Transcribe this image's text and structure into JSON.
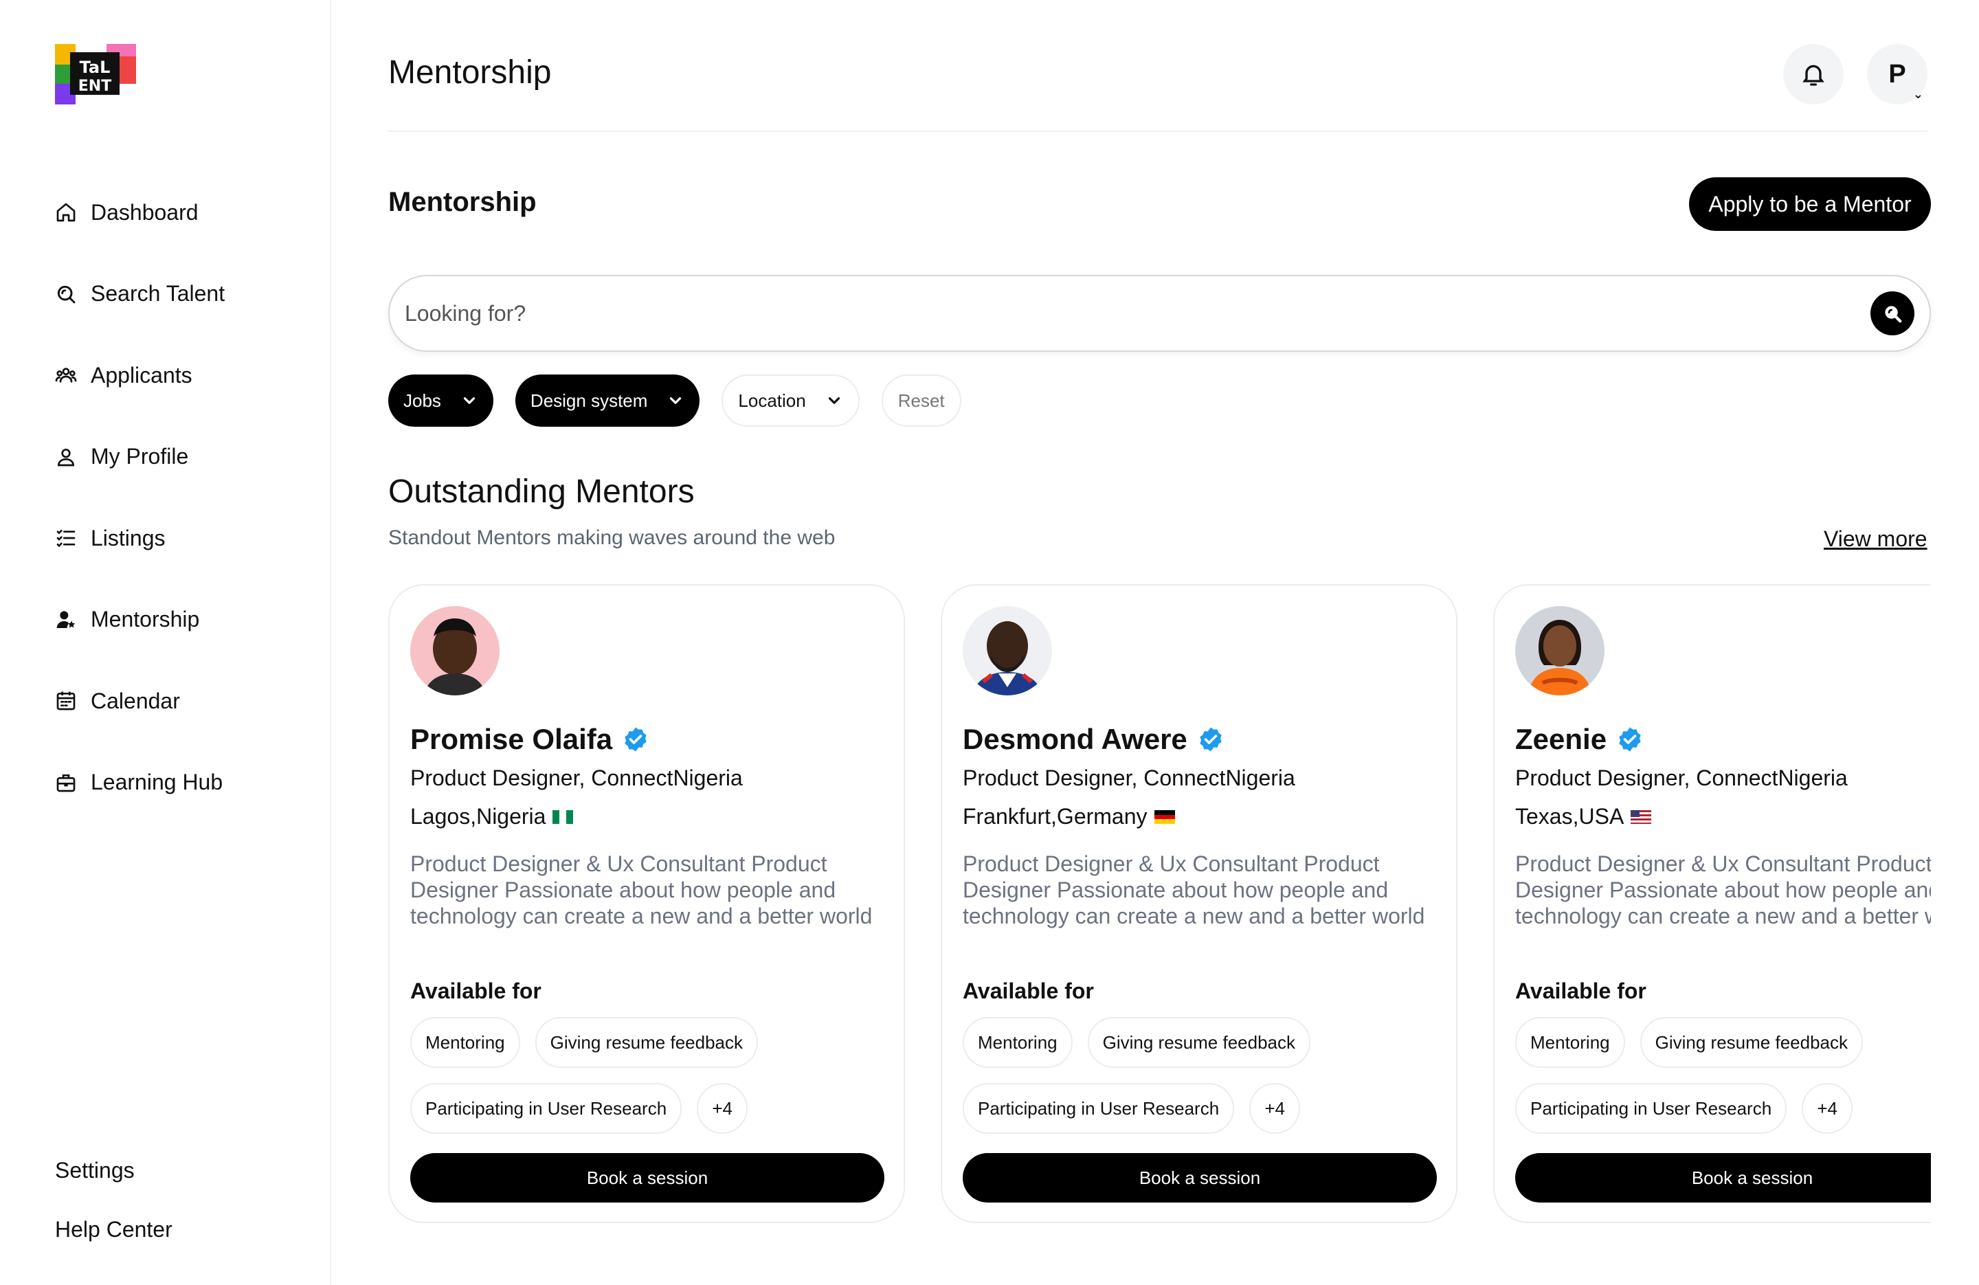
{
  "brand": {
    "logo_text_line1": "TaL",
    "logo_text_line2": "ENT"
  },
  "sidebar": {
    "items": [
      {
        "label": "Dashboard",
        "icon": "home-icon"
      },
      {
        "label": "Search Talent",
        "icon": "search-icon"
      },
      {
        "label": "Applicants",
        "icon": "users-icon"
      },
      {
        "label": "My Profile",
        "icon": "user-icon"
      },
      {
        "label": "Listings",
        "icon": "list-icon"
      },
      {
        "label": "Mentorship",
        "icon": "mentorship-icon",
        "active": true
      },
      {
        "label": "Calendar",
        "icon": "calendar-icon"
      },
      {
        "label": "Learning Hub",
        "icon": "briefcase-icon"
      }
    ],
    "bottom": {
      "settings": "Settings",
      "help": "Help Center"
    }
  },
  "header": {
    "title": "Mentorship",
    "avatar_initial": "P"
  },
  "main": {
    "section_title": "Mentorship",
    "apply_label": "Apply to be a Mentor",
    "search": {
      "placeholder": "Looking for?"
    },
    "filters": [
      {
        "label": "Jobs",
        "style": "dark"
      },
      {
        "label": "Design system",
        "style": "dark"
      },
      {
        "label": "Location",
        "style": "light"
      }
    ],
    "reset_label": "Reset",
    "outstanding": {
      "title": "Outstanding Mentors",
      "subtitle": "Standout Mentors making waves around the web",
      "view_more": "View more"
    }
  },
  "mentors": [
    {
      "name": "Promise Olaifa",
      "role": "Product Designer, ConnectNigeria",
      "location": "Lagos,Nigeria",
      "flag": "nigeria",
      "bio": "Product Designer & Ux Consultant Product Designer Passionate about how people and technology can create a new and a better world",
      "available_label": "Available for",
      "tags": [
        "Mentoring",
        "Giving resume feedback",
        "Participating in User Research"
      ],
      "more": "+4",
      "book_label": "Book a session"
    },
    {
      "name": "Desmond Awere",
      "role": "Product Designer, ConnectNigeria",
      "location": "Frankfurt,Germany",
      "flag": "germany",
      "bio": "Product Designer & Ux Consultant Product Designer Passionate about how people and technology can create a new and a better world",
      "available_label": "Available for",
      "tags": [
        "Mentoring",
        "Giving resume feedback",
        "Participating in User Research"
      ],
      "more": "+4",
      "book_label": "Book a session"
    },
    {
      "name": "Zeenie",
      "role": "Product Designer, ConnectNigeria",
      "location": "Texas,USA",
      "flag": "usa",
      "bio": "Product Designer & Ux Consultant Product Designer Passionate about how people and technology can create a new and a better world",
      "available_label": "Available for",
      "tags": [
        "Mentoring",
        "Giving resume feedback",
        "Participating in User Research"
      ],
      "more": "+4",
      "book_label": "Book a session"
    }
  ],
  "colors": {
    "accent": "#000000",
    "verified": "#1d9bf0",
    "muted_text": "#6b7280"
  }
}
